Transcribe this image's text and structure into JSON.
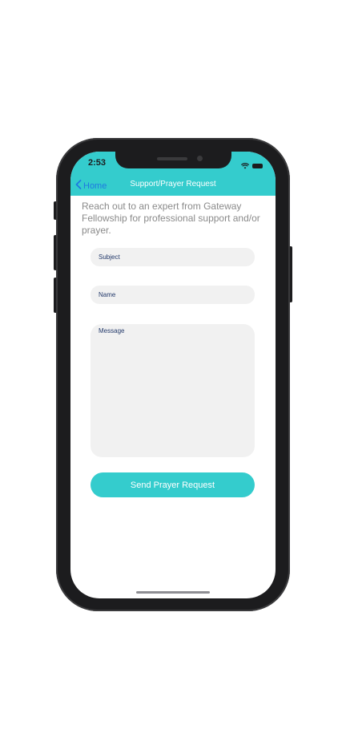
{
  "status_bar": {
    "time": "2:53",
    "icons": [
      "wifi-icon",
      "battery-icon"
    ]
  },
  "nav": {
    "back_label": "Home",
    "back_icon": "chevron-left-icon",
    "title": "Support/Prayer Request"
  },
  "intro_text": "Reach out to an expert from Gateway Fellowship for professional support and/or prayer.",
  "form": {
    "subject_placeholder": "Subject",
    "name_placeholder": "Name",
    "message_placeholder": "Message",
    "submit_label": "Send Prayer Request"
  },
  "colors": {
    "accent": "#34cccd",
    "back_link": "#1f7ae0",
    "field_bg": "#f1f1f1",
    "field_text": "#243a6b",
    "intro_text": "#8a8a8a"
  }
}
